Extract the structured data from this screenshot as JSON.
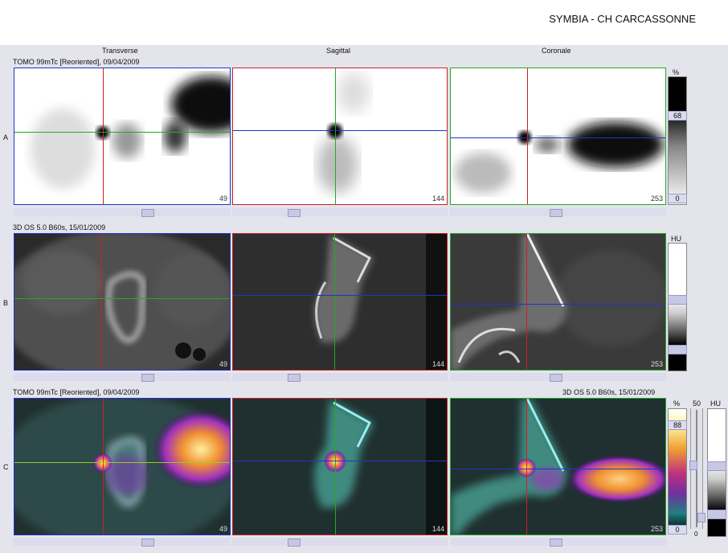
{
  "header": {
    "title": "SYMBIA - CH CARCASSONNE"
  },
  "columns": {
    "transverse": "Transverse",
    "sagittal": "Sagittal",
    "coronal": "Coronale"
  },
  "rows": {
    "a": {
      "label": "A",
      "series": "TOMO 99mTc [Reoriented], 09/04/2009"
    },
    "b": {
      "label": "B",
      "series": "3D  OS  5.0  B60s, 15/01/2009"
    },
    "c": {
      "label": "C",
      "series_left": "TOMO 99mTc [Reoriented], 09/04/2009",
      "series_right": "3D  OS  5.0  B60s, 15/01/2009"
    }
  },
  "slices": {
    "transverse": "49",
    "sagittal": "144",
    "coronal": "253"
  },
  "colorbars": {
    "a": {
      "unit": "%",
      "top": "68",
      "bottom": "0"
    },
    "b": {
      "unit": "HU"
    },
    "c": {
      "unit": "%",
      "top": "88",
      "bottom": "0",
      "fusion_top": "50",
      "fusion_bottom": "0",
      "ct_unit": "HU"
    }
  },
  "crosshair_colors": {
    "transverse": "#cc2222",
    "sagittal": "#22aa22",
    "coronal": "#2233cc"
  },
  "icons": {
    "scroll_thumb": "slider-thumb-icon"
  }
}
